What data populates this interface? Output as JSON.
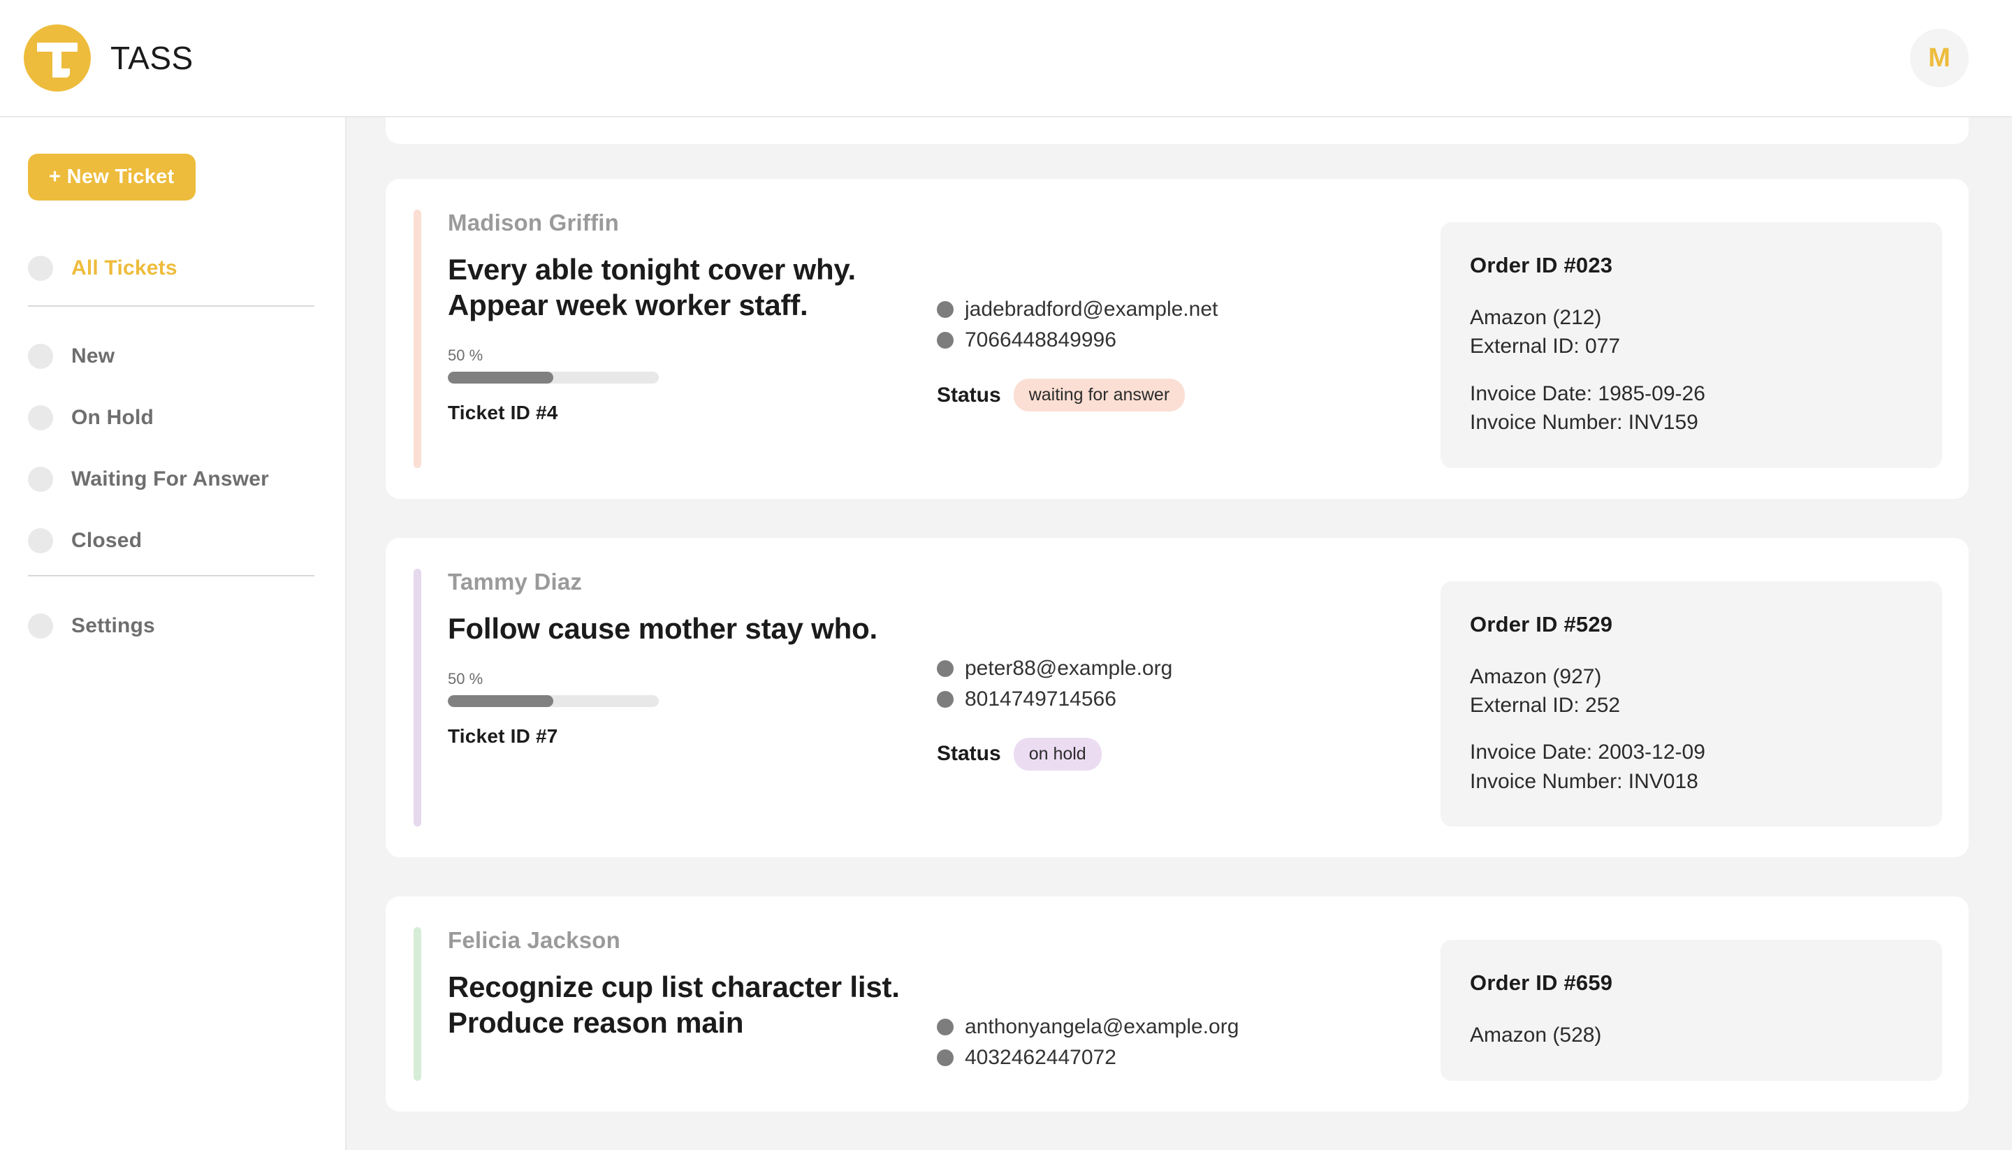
{
  "header": {
    "brand_name": "TASS",
    "logo_icon": "letter-t-logo-icon",
    "avatar_initial": "M"
  },
  "sidebar": {
    "new_ticket_label": "+ New Ticket",
    "primary_items": [
      {
        "label": "All Tickets",
        "active": true
      }
    ],
    "status_items": [
      {
        "label": "New",
        "active": false
      },
      {
        "label": "On Hold",
        "active": false
      },
      {
        "label": "Waiting For Answer",
        "active": false
      },
      {
        "label": "Closed",
        "active": false
      }
    ],
    "footer_items": [
      {
        "label": "Settings",
        "active": false
      }
    ]
  },
  "colors": {
    "brand_yellow": "#eebc3c",
    "accent_waiting": "#fbdfd4",
    "accent_onhold": "#e5d9ee",
    "accent_closed": "#d6ecd6",
    "badge_waiting_bg": "#fbdfd4",
    "badge_onhold_bg": "#ecdcf2",
    "progress_fill": "#808080",
    "progress_track": "#e8e8e8"
  },
  "main": {
    "labels": {
      "status": "Status",
      "percent_suffix": "%"
    },
    "tickets": [
      {
        "clipped": true,
        "accent_color": "#ffffff",
        "requester": "",
        "subject": "",
        "progress_label": "",
        "progress_value": 0,
        "ticket_id": "",
        "email": "",
        "phone": "",
        "status": "",
        "status_bg": "#ffffff",
        "order_id": "",
        "vendor": "",
        "external_id": "",
        "invoice_date": "",
        "invoice_number": ""
      },
      {
        "clipped": false,
        "accent_color": "#fbdfd4",
        "requester": "Madison Griffin",
        "subject": "Every able tonight cover why. Appear week worker staff.",
        "progress_label": "50 %",
        "progress_value": 50,
        "ticket_id": "Ticket ID #4",
        "email": "jadebradford@example.net",
        "phone": "7066448849996",
        "status": "waiting for answer",
        "status_bg": "#fbdfd4",
        "order_id": "Order ID #023",
        "vendor": "Amazon (212)",
        "external_id": "External ID: 077",
        "invoice_date": "Invoice Date: 1985-09-26",
        "invoice_number": "Invoice Number: INV159"
      },
      {
        "clipped": false,
        "accent_color": "#e5d9ee",
        "requester": "Tammy Diaz",
        "subject": "Follow cause mother stay who.",
        "progress_label": "50 %",
        "progress_value": 50,
        "ticket_id": "Ticket ID #7",
        "email": "peter88@example.org",
        "phone": "8014749714566",
        "status": "on hold",
        "status_bg": "#ecdcf2",
        "order_id": "Order ID #529",
        "vendor": "Amazon (927)",
        "external_id": "External ID: 252",
        "invoice_date": "Invoice Date: 2003-12-09",
        "invoice_number": "Invoice Number: INV018"
      },
      {
        "clipped": false,
        "accent_color": "#d6ecd6",
        "requester": "Felicia Jackson",
        "subject": "Recognize cup list character list. Produce reason main",
        "progress_label": "",
        "progress_value": 0,
        "ticket_id": "",
        "email": "anthonyangela@example.org",
        "phone": "4032462447072",
        "status": "",
        "status_bg": "#ffffff",
        "order_id": "Order ID #659",
        "vendor": "Amazon (528)",
        "external_id": "",
        "invoice_date": "",
        "invoice_number": ""
      }
    ]
  }
}
